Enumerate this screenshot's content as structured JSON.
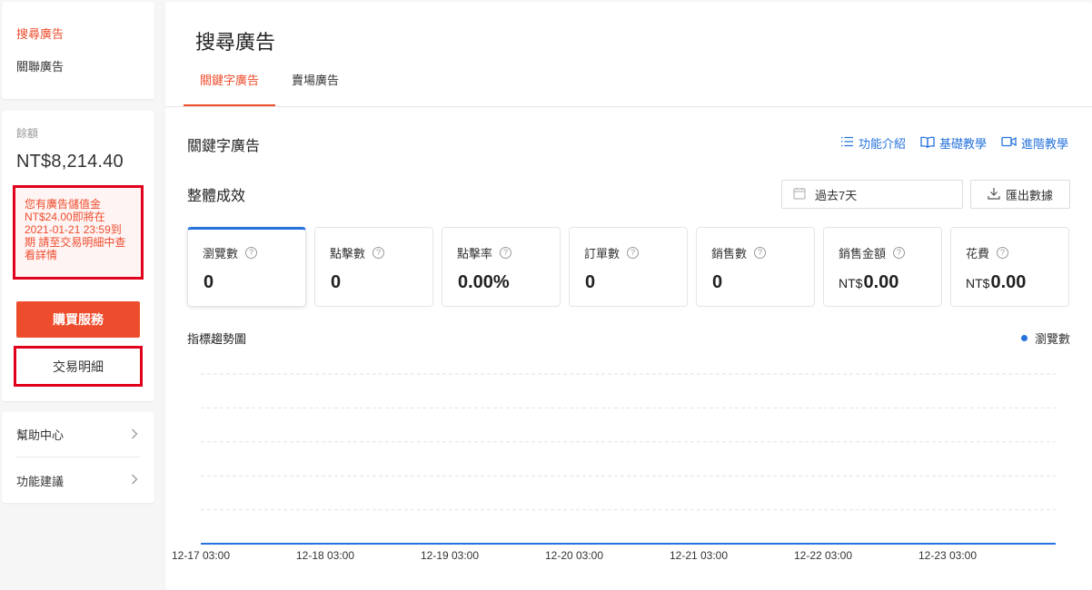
{
  "sidebar": {
    "nav": [
      {
        "label": "搜尋廣告",
        "active": true
      },
      {
        "label": "關聯廣告",
        "active": false
      }
    ],
    "balance_label": "餘額",
    "balance_value": "NT$8,214.40",
    "warning": "您有廣告儲值金NT$24.00即將在2021-01-21 23:59到期 請至交易明細中查看詳情",
    "buy_label": "購買服務",
    "transactions_label": "交易明細",
    "help": [
      {
        "label": "幫助中心"
      },
      {
        "label": "功能建議"
      }
    ]
  },
  "main": {
    "title": "搜尋廣告",
    "tabs": [
      {
        "label": "關鍵字廣告",
        "active": true
      },
      {
        "label": "賣場廣告",
        "active": false
      }
    ],
    "section_title": "關鍵字廣告",
    "help_links": [
      {
        "label": "功能介紹",
        "icon": "list-icon"
      },
      {
        "label": "基礎教學",
        "icon": "book-icon"
      },
      {
        "label": "進階教學",
        "icon": "video-icon"
      }
    ],
    "performance_title": "整體成效",
    "date_range": "過去7天",
    "export_label": "匯出數據",
    "metrics": [
      {
        "label": "瀏覽數",
        "unit": "",
        "value": "0",
        "selected": true
      },
      {
        "label": "點擊數",
        "unit": "",
        "value": "0",
        "selected": false
      },
      {
        "label": "點擊率",
        "unit": "",
        "value": "0.00%",
        "selected": false
      },
      {
        "label": "訂單數",
        "unit": "",
        "value": "0",
        "selected": false
      },
      {
        "label": "銷售數",
        "unit": "",
        "value": "0",
        "selected": false
      },
      {
        "label": "銷售金額",
        "unit": "NT$",
        "value": "0.00",
        "selected": false
      },
      {
        "label": "花費",
        "unit": "NT$",
        "value": "0.00",
        "selected": false
      }
    ],
    "trend_title": "指標趨勢圖",
    "legend_label": "瀏覽數",
    "colors": {
      "accent": "#ee4d2d",
      "series": "#2673dd",
      "alert_border": "#e0001b"
    }
  },
  "chart_data": {
    "type": "line",
    "x_ticks": [
      "12-17 03:00",
      "12-18 03:00",
      "12-19 03:00",
      "12-20 03:00",
      "12-21 03:00",
      "12-22 03:00",
      "12-23 03:00"
    ],
    "series": [
      {
        "name": "瀏覽數",
        "values": [
          0,
          0,
          0,
          0,
          0,
          0,
          0
        ]
      }
    ],
    "ylim": [
      0,
      5
    ],
    "grid": true,
    "legend": "top-right"
  }
}
